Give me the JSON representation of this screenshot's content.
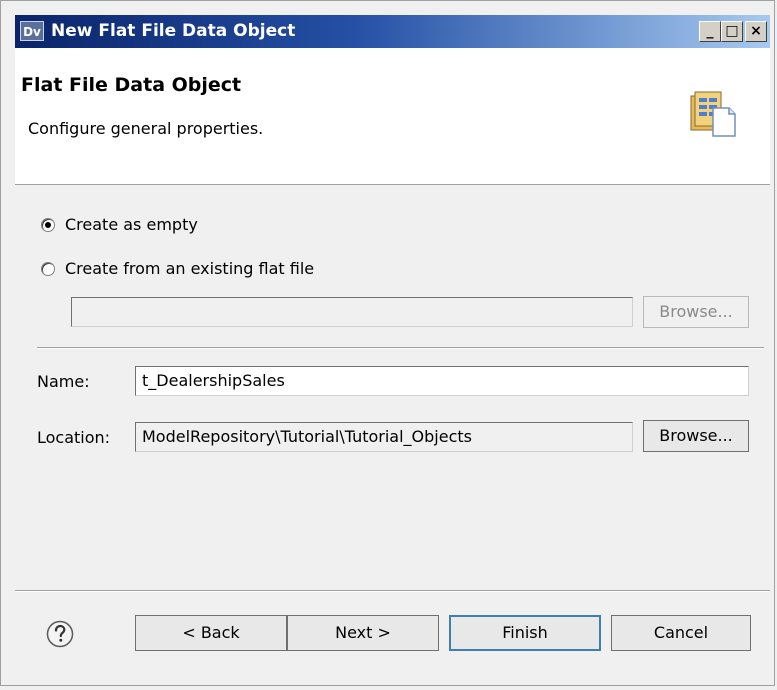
{
  "window": {
    "icon_text": "Dv",
    "title": "New Flat File Data Object",
    "minimize_glyph": "_",
    "maximize_glyph": "□",
    "close_glyph": "×"
  },
  "banner": {
    "title": "Flat File Data Object",
    "description": "Configure general properties.",
    "icon": "flat-file-wizard-icon"
  },
  "options": {
    "create_empty_label": "Create as empty",
    "create_empty_selected": true,
    "create_existing_label": "Create from an existing flat file",
    "create_existing_selected": false,
    "file_path_value": "",
    "file_browse_label": "Browse..."
  },
  "fields": {
    "name_label": "Name:",
    "name_value": "t_DealershipSales",
    "location_label": "Location:",
    "location_value": "ModelRepository\\Tutorial\\Tutorial_Objects",
    "location_browse_label": "Browse..."
  },
  "footer": {
    "help_icon": "help-icon",
    "back_label": "< Back",
    "next_label": "Next >",
    "finish_label": "Finish",
    "cancel_label": "Cancel"
  }
}
